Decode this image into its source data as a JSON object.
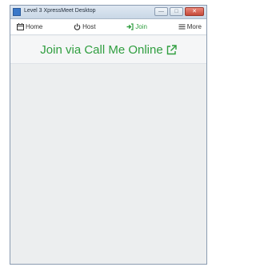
{
  "window": {
    "title": "Level 3 XpressMeet Desktop",
    "buttons": {
      "minimize": "—",
      "maximize": "□",
      "close": "✕"
    }
  },
  "nav": {
    "items": [
      {
        "label": "Home",
        "icon": "calendar-icon",
        "active": false
      },
      {
        "label": "Host",
        "icon": "power-icon",
        "active": false
      },
      {
        "label": "Join",
        "icon": "sign-in-icon",
        "active": true
      },
      {
        "label": "More",
        "icon": "menu-icon",
        "active": false
      }
    ]
  },
  "main": {
    "title": "Join via Call Me Online",
    "title_icon": "external-link-icon"
  },
  "colors": {
    "accent_green": "#2f9e3f",
    "nav_text": "#333333",
    "body_bg": "#eceeef"
  }
}
